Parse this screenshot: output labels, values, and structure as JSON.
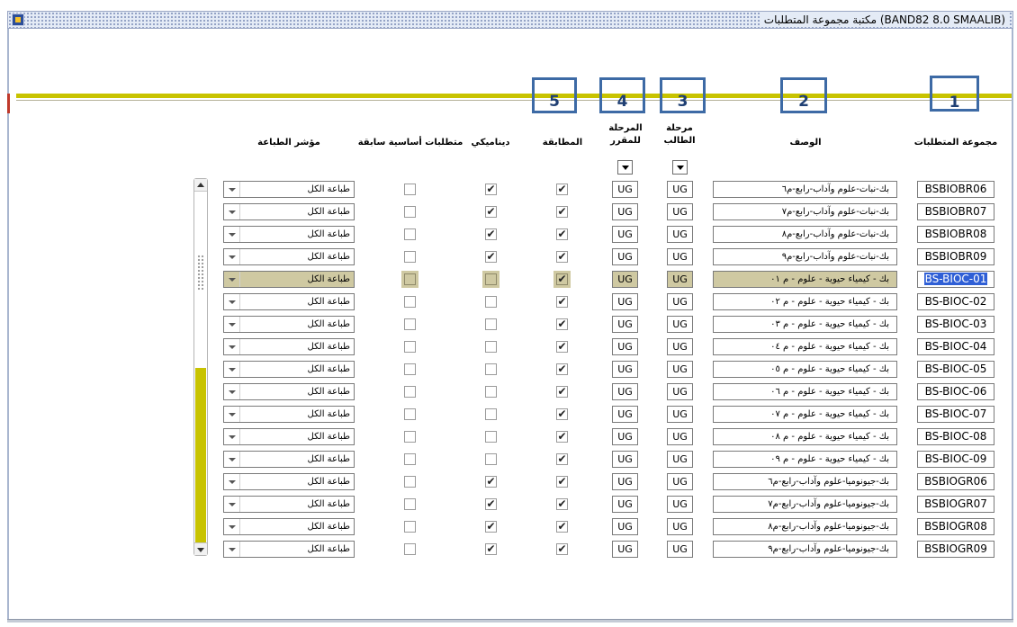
{
  "window": {
    "title": "مكتبة مجموعة المتطلبات (BAND82 8.0 SMAALIB)"
  },
  "markers": [
    "1",
    "2",
    "3",
    "4",
    "5"
  ],
  "headers": {
    "rule_group": "مجموعة المتطلبات",
    "description": "الوصف",
    "student_level": "مرحلة الطالب",
    "course_level": "المرحلة للمقرر",
    "match": "المطابقة",
    "dynamic": "ديناميكي",
    "prereq": "متطلبات أساسية سابقة",
    "print_indicator": "مؤشر الطباعة"
  },
  "selected_row_index": 4,
  "rows": [
    {
      "rule": "BSBIOBR06",
      "desc": "بك-نبات-علوم وآداب-رابع-م٦",
      "student_level": "UG",
      "course_level": "UG",
      "match": true,
      "dynamic": true,
      "prereq": false,
      "print": "طباعة الكل"
    },
    {
      "rule": "BSBIOBR07",
      "desc": "بك-نبات-علوم وآداب-رابع-م٧",
      "student_level": "UG",
      "course_level": "UG",
      "match": true,
      "dynamic": true,
      "prereq": false,
      "print": "طباعة الكل"
    },
    {
      "rule": "BSBIOBR08",
      "desc": "بك-نبات-علوم وآداب-رابع-م٨",
      "student_level": "UG",
      "course_level": "UG",
      "match": true,
      "dynamic": true,
      "prereq": false,
      "print": "طباعة الكل"
    },
    {
      "rule": "BSBIOBR09",
      "desc": "بك-نبات-علوم وآداب-رابع-م٩",
      "student_level": "UG",
      "course_level": "UG",
      "match": true,
      "dynamic": true,
      "prereq": false,
      "print": "طباعة الكل"
    },
    {
      "rule": "BS-BIOC-01",
      "desc": "بك - كيمياء حيوية - علوم - م ٠١",
      "student_level": "UG",
      "course_level": "UG",
      "match": true,
      "dynamic": false,
      "prereq": false,
      "print": "طباعة الكل"
    },
    {
      "rule": "BS-BIOC-02",
      "desc": "بك - كيمياء حيوية - علوم - م ٠٢",
      "student_level": "UG",
      "course_level": "UG",
      "match": true,
      "dynamic": false,
      "prereq": false,
      "print": "طباعة الكل"
    },
    {
      "rule": "BS-BIOC-03",
      "desc": "بك - كيمياء حيوية - علوم - م ٠٣",
      "student_level": "UG",
      "course_level": "UG",
      "match": true,
      "dynamic": false,
      "prereq": false,
      "print": "طباعة الكل"
    },
    {
      "rule": "BS-BIOC-04",
      "desc": "بك - كيمياء حيوية - علوم - م ٠٤",
      "student_level": "UG",
      "course_level": "UG",
      "match": true,
      "dynamic": false,
      "prereq": false,
      "print": "طباعة الكل"
    },
    {
      "rule": "BS-BIOC-05",
      "desc": "بك - كيمياء حيوية - علوم - م ٠٥",
      "student_level": "UG",
      "course_level": "UG",
      "match": true,
      "dynamic": false,
      "prereq": false,
      "print": "طباعة الكل"
    },
    {
      "rule": "BS-BIOC-06",
      "desc": "بك - كيمياء حيوية - علوم - م ٠٦",
      "student_level": "UG",
      "course_level": "UG",
      "match": true,
      "dynamic": false,
      "prereq": false,
      "print": "طباعة الكل"
    },
    {
      "rule": "BS-BIOC-07",
      "desc": "بك - كيمياء حيوية - علوم - م ٠٧",
      "student_level": "UG",
      "course_level": "UG",
      "match": true,
      "dynamic": false,
      "prereq": false,
      "print": "طباعة الكل"
    },
    {
      "rule": "BS-BIOC-08",
      "desc": "بك - كيمياء حيوية - علوم - م ٠٨",
      "student_level": "UG",
      "course_level": "UG",
      "match": true,
      "dynamic": false,
      "prereq": false,
      "print": "طباعة الكل"
    },
    {
      "rule": "BS-BIOC-09",
      "desc": "بك - كيمياء حيوية - علوم - م ٠٩",
      "student_level": "UG",
      "course_level": "UG",
      "match": true,
      "dynamic": false,
      "prereq": false,
      "print": "طباعة الكل"
    },
    {
      "rule": "BSBIOGR06",
      "desc": "بك-جيونوميا-علوم وآداب-رابع-م٦",
      "student_level": "UG",
      "course_level": "UG",
      "match": true,
      "dynamic": true,
      "prereq": false,
      "print": "طباعة الكل"
    },
    {
      "rule": "BSBIOGR07",
      "desc": "بك-جيونوميا-علوم وآداب-رابع-م٧",
      "student_level": "UG",
      "course_level": "UG",
      "match": true,
      "dynamic": true,
      "prereq": false,
      "print": "طباعة الكل"
    },
    {
      "rule": "BSBIOGR08",
      "desc": "بك-جيونوميا-علوم وآداب-رابع-م٨",
      "student_level": "UG",
      "course_level": "UG",
      "match": true,
      "dynamic": true,
      "prereq": false,
      "print": "طباعة الكل"
    },
    {
      "rule": "BSBIOGR09",
      "desc": "بك-جيونوميا-علوم وآداب-رابع-م٩",
      "student_level": "UG",
      "course_level": "UG",
      "match": true,
      "dynamic": true,
      "prereq": false,
      "print": "طباعة الكل"
    }
  ],
  "colors": {
    "accent_olive": "#c8c300",
    "selected_row": "#cfc9a2",
    "selection_highlight": "#2f5fd6",
    "marker_border": "#3d6aa5"
  }
}
